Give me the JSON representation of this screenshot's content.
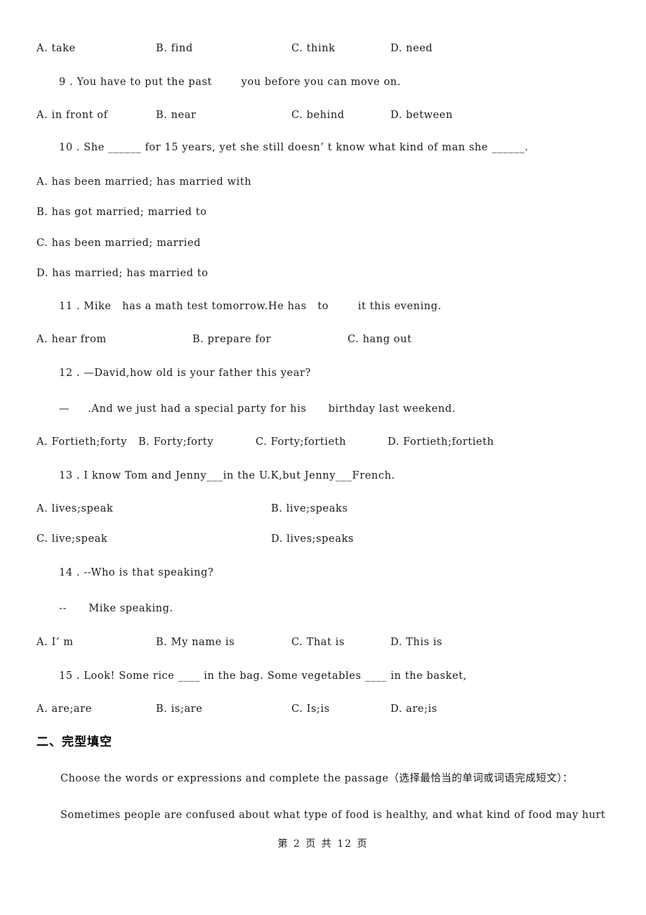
{
  "document": {
    "background_color": "#ffffff",
    "text_color": "#1a1a1a"
  },
  "questions": [
    {
      "id": "q8-options",
      "stem": null,
      "options": [
        {
          "label": "A. take"
        },
        {
          "label": "B. find"
        },
        {
          "label": "C. think"
        },
        {
          "label": "D. need"
        }
      ]
    },
    {
      "id": "q9",
      "number": "9",
      "stem": "9 . You have to put the past        you before you can move on.",
      "options": [
        {
          "label": "A. in front of"
        },
        {
          "label": "B. near"
        },
        {
          "label": "C. behind"
        },
        {
          "label": "D. between"
        }
      ]
    },
    {
      "id": "q10",
      "number": "10",
      "stem": "10 . She ______ for 15 years, yet she still doesn’ t know what kind of man she ______.",
      "options": [
        {
          "label": "A. has been married; has married with"
        },
        {
          "label": "B. has got married; married to"
        },
        {
          "label": "C. has been married; married"
        },
        {
          "label": "D. has married; has married to"
        }
      ]
    },
    {
      "id": "q11",
      "number": "11",
      "stem": "11 . Mike   has a math test tomorrow.He has   to        it this evening.",
      "options": [
        {
          "label": "A. hear from"
        },
        {
          "label": "B. prepare for"
        },
        {
          "label": "C. hang out"
        }
      ]
    },
    {
      "id": "q12",
      "number": "12",
      "stem": "12 . —David,how old is your father this year?",
      "stem2": "—     .And we just had a special party for his      birthday last weekend.",
      "options": [
        {
          "label": "A. Fortieth;forty"
        },
        {
          "label": "B. Forty;forty"
        },
        {
          "label": "C. Forty;fortieth"
        },
        {
          "label": "D. Fortieth;fortieth"
        }
      ]
    },
    {
      "id": "q13",
      "number": "13",
      "stem": "13 . I know Tom and Jenny___in the U.K,but Jenny___French.",
      "options": [
        {
          "label": "A. lives;speak"
        },
        {
          "label": "B. live;speaks"
        },
        {
          "label": "C. live;speak"
        },
        {
          "label": "D. lives;speaks"
        }
      ]
    },
    {
      "id": "q14",
      "number": "14",
      "stem": "14 . --Who is that speaking?",
      "stem2": "--      Mike speaking.",
      "options": [
        {
          "label": "A. I’ m"
        },
        {
          "label": "B. My name is"
        },
        {
          "label": "C. That is"
        },
        {
          "label": "D. This is"
        }
      ]
    },
    {
      "id": "q15",
      "number": "15",
      "stem": "15 . Look! Some rice ____ in the bag. Some vegetables ____ in the basket,",
      "options": [
        {
          "label": "A. are;are"
        },
        {
          "label": "B. is;are"
        },
        {
          "label": "C. Is;is"
        },
        {
          "label": "D. are;is"
        }
      ]
    }
  ],
  "section": {
    "heading": "二、完型填空",
    "instruction": "Choose the words or expressions and complete the passage（选择最恰当的单词或词语完成短文）：",
    "passage_line1": "Sometimes people are confused about what type of food is healthy, and what kind of food may hurt"
  },
  "footer": {
    "text": "第 2 页 共 12 页"
  }
}
